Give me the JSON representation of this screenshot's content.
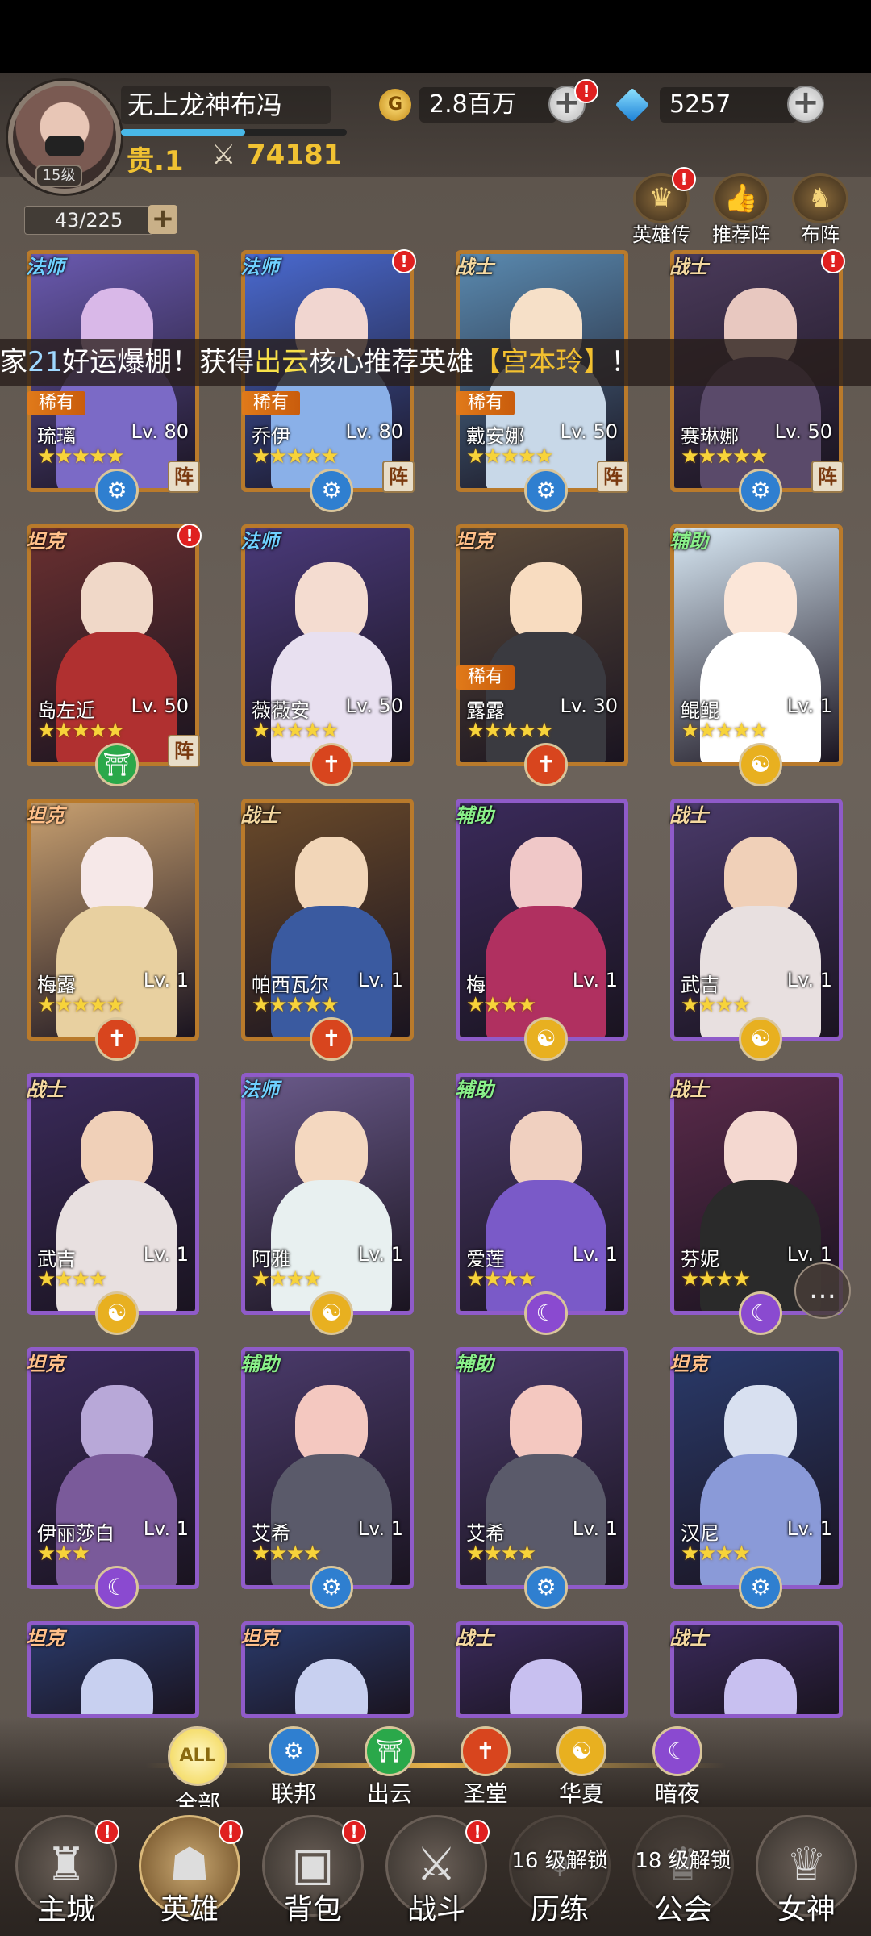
{
  "player": {
    "name": "无上龙神布冯",
    "level": "15级",
    "vip": "贵.1",
    "power": "74181",
    "exp_progress": 0.55
  },
  "currency": {
    "gold": "2.8百万",
    "gold_symbol": "G",
    "diamonds": "5257"
  },
  "capacity": "43/225",
  "top_buttons": [
    {
      "label": "英雄传",
      "icon": "crown-icon",
      "badge": "!"
    },
    {
      "label": "推荐阵",
      "icon": "thumb-up-icon",
      "badge": ""
    },
    {
      "label": "布阵",
      "icon": "chess-knight-icon",
      "badge": ""
    }
  ],
  "broadcast": {
    "prefix": "家",
    "num": "21",
    "mid": "好运爆棚！获得",
    "faction": "出云",
    "mid2": "核心推荐英雄",
    "hero": "【宫本玲】",
    "suffix": "！"
  },
  "class_labels": {
    "mage": "法师",
    "warrior": "战士",
    "tank": "坦克",
    "support": "辅助"
  },
  "rare_label": "稀有",
  "formation_label": "阵",
  "heroes": [
    {
      "name": "琉璃",
      "level": "Lv. 80",
      "class": "法师",
      "rare": true,
      "stars": "★★★★★",
      "faction": "联邦",
      "formation": true,
      "badge": false,
      "frame": "gold"
    },
    {
      "name": "乔伊",
      "level": "Lv. 80",
      "class": "法师",
      "rare": true,
      "stars": "★★★★★",
      "faction": "联邦",
      "formation": true,
      "badge": true,
      "frame": "gold"
    },
    {
      "name": "戴安娜",
      "level": "Lv. 50",
      "class": "战士",
      "rare": true,
      "stars": "★★★★★",
      "faction": "联邦",
      "formation": true,
      "badge": false,
      "frame": "gold"
    },
    {
      "name": "赛琳娜",
      "level": "Lv. 50",
      "class": "战士",
      "rare": false,
      "stars": "★★★★★",
      "faction": "联邦",
      "formation": true,
      "badge": true,
      "frame": "gold"
    },
    {
      "name": "岛左近",
      "level": "Lv. 50",
      "class": "坦克",
      "rare": false,
      "stars": "★★★★★",
      "faction": "出云",
      "formation": true,
      "badge": true,
      "frame": "gold"
    },
    {
      "name": "薇薇安",
      "level": "Lv. 50",
      "class": "法师",
      "rare": false,
      "stars": "★★★★★",
      "faction": "圣堂",
      "formation": false,
      "badge": false,
      "frame": "gold"
    },
    {
      "name": "露露",
      "level": "Lv. 30",
      "class": "坦克",
      "rare": true,
      "stars": "★★★★★",
      "faction": "圣堂",
      "formation": false,
      "badge": false,
      "frame": "gold"
    },
    {
      "name": "鲲鲲",
      "level": "Lv. 1",
      "class": "辅助",
      "rare": false,
      "stars": "★★★★★",
      "faction": "华夏",
      "formation": false,
      "badge": false,
      "frame": "gold"
    },
    {
      "name": "梅露",
      "level": "Lv. 1",
      "class": "坦克",
      "rare": false,
      "stars": "★★★★★",
      "faction": "圣堂",
      "formation": false,
      "badge": false,
      "frame": "gold"
    },
    {
      "name": "帕西瓦尔",
      "level": "Lv. 1",
      "class": "战士",
      "rare": false,
      "stars": "★★★★★",
      "faction": "圣堂",
      "formation": false,
      "badge": false,
      "frame": "gold"
    },
    {
      "name": "梅",
      "level": "Lv. 1",
      "class": "辅助",
      "rare": false,
      "stars": "★★★★",
      "faction": "华夏",
      "formation": false,
      "badge": false,
      "frame": "purple"
    },
    {
      "name": "武吉",
      "level": "Lv. 1",
      "class": "战士",
      "rare": false,
      "stars": "★★★★",
      "faction": "华夏",
      "formation": false,
      "badge": false,
      "frame": "purple"
    },
    {
      "name": "武吉",
      "level": "Lv. 1",
      "class": "战士",
      "rare": false,
      "stars": "★★★★",
      "faction": "华夏",
      "formation": false,
      "badge": false,
      "frame": "purple"
    },
    {
      "name": "阿雅",
      "level": "Lv. 1",
      "class": "法师",
      "rare": false,
      "stars": "★★★★",
      "faction": "华夏",
      "formation": false,
      "badge": false,
      "frame": "purple"
    },
    {
      "name": "爱莲",
      "level": "Lv. 1",
      "class": "辅助",
      "rare": false,
      "stars": "★★★★",
      "faction": "暗夜",
      "formation": false,
      "badge": false,
      "frame": "purple"
    },
    {
      "name": "芬妮",
      "level": "Lv. 1",
      "class": "战士",
      "rare": false,
      "stars": "★★★★",
      "faction": "暗夜",
      "formation": false,
      "badge": false,
      "frame": "purple"
    },
    {
      "name": "伊丽莎白",
      "level": "Lv. 1",
      "class": "坦克",
      "rare": false,
      "stars": "★★★",
      "faction": "暗夜",
      "formation": false,
      "badge": false,
      "frame": "purple"
    },
    {
      "name": "艾希",
      "level": "Lv. 1",
      "class": "辅助",
      "rare": false,
      "stars": "★★★★",
      "faction": "联邦",
      "formation": false,
      "badge": false,
      "frame": "purple"
    },
    {
      "name": "艾希",
      "level": "Lv. 1",
      "class": "辅助",
      "rare": false,
      "stars": "★★★★",
      "faction": "联邦",
      "formation": false,
      "badge": false,
      "frame": "purple"
    },
    {
      "name": "汉尼",
      "level": "Lv. 1",
      "class": "坦克",
      "rare": false,
      "stars": "★★★★",
      "faction": "联邦",
      "formation": false,
      "badge": false,
      "frame": "purple"
    },
    {
      "name": "",
      "level": "",
      "class": "坦克",
      "rare": false,
      "stars": "",
      "faction": "",
      "formation": false,
      "badge": false,
      "frame": "purple"
    },
    {
      "name": "",
      "level": "",
      "class": "坦克",
      "rare": false,
      "stars": "",
      "faction": "",
      "formation": false,
      "badge": false,
      "frame": "purple"
    },
    {
      "name": "",
      "level": "",
      "class": "战士",
      "rare": false,
      "stars": "",
      "faction": "",
      "formation": false,
      "badge": false,
      "frame": "purple"
    },
    {
      "name": "",
      "level": "",
      "class": "战士",
      "rare": false,
      "stars": "",
      "faction": "",
      "formation": false,
      "badge": false,
      "frame": "purple"
    }
  ],
  "factions": [
    {
      "label": "全部",
      "icon_text": "ALL",
      "icon": "all-icon",
      "color": "#f1d34a",
      "active": true
    },
    {
      "label": "联邦",
      "icon_text": "⚙",
      "icon": "gear-icon",
      "color": "#2f7fd0",
      "active": false
    },
    {
      "label": "出云",
      "icon_text": "⛩",
      "icon": "torii-icon",
      "color": "#2aa84a",
      "active": false
    },
    {
      "label": "圣堂",
      "icon_text": "✝",
      "icon": "cross-icon",
      "color": "#d8451e",
      "active": false
    },
    {
      "label": "华夏",
      "icon_text": "☯",
      "icon": "cloud-icon",
      "color": "#e8b020",
      "active": false
    },
    {
      "label": "暗夜",
      "icon_text": "☾",
      "icon": "moon-icon",
      "color": "#8a4ad0",
      "active": false
    }
  ],
  "nav": [
    {
      "label": "主城",
      "icon": "castle-icon",
      "glyph": "♜",
      "badge": "!",
      "lock": "",
      "active": false
    },
    {
      "label": "英雄",
      "icon": "hero-icon",
      "glyph": "☗",
      "badge": "!",
      "lock": "",
      "active": true
    },
    {
      "label": "背包",
      "icon": "backpack-icon",
      "glyph": "▣",
      "badge": "!",
      "lock": "",
      "active": false
    },
    {
      "label": "战斗",
      "icon": "swords-icon",
      "glyph": "⚔",
      "badge": "!",
      "lock": "",
      "active": false
    },
    {
      "label": "历练",
      "icon": "map-pin-icon",
      "glyph": "⌖",
      "badge": "",
      "lock": "16 级解锁",
      "active": false
    },
    {
      "label": "公会",
      "icon": "guild-icon",
      "glyph": "♛",
      "badge": "",
      "lock": "18 级解锁",
      "active": false
    },
    {
      "label": "女神",
      "icon": "goddess-icon",
      "glyph": "♕",
      "badge": "",
      "lock": "",
      "active": false
    }
  ],
  "chat_icon": "chat-bubble-icon",
  "colors": {
    "gold_frame": "#b97a2b",
    "purple_frame": "#8f5bc9",
    "accent_gold": "#f1c232"
  }
}
